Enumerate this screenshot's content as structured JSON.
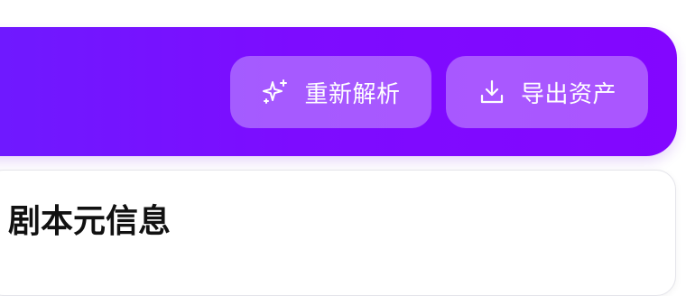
{
  "header": {
    "reparse_label": "重新解析",
    "export_label": "导出资产",
    "colors": {
      "gradient_start": "#6e1aff",
      "gradient_end": "#8306ff",
      "button_bg": "rgba(255,255,255,0.32)"
    }
  },
  "card": {
    "title": "剧本元信息"
  }
}
